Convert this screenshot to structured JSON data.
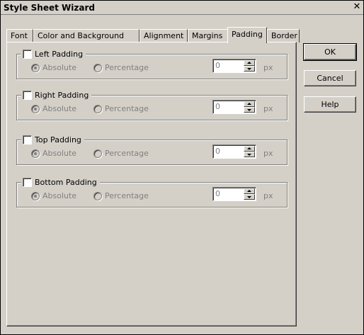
{
  "window": {
    "title": "Style Sheet Wizard",
    "close_glyph": "✕"
  },
  "tabs": [
    {
      "label": "Font",
      "active": false
    },
    {
      "label": "Color and Background",
      "active": false
    },
    {
      "label": "Alignment",
      "active": false
    },
    {
      "label": "Margins",
      "active": false
    },
    {
      "label": "Padding",
      "active": true
    },
    {
      "label": "Border",
      "active": false
    }
  ],
  "groups": [
    {
      "label": "Left Padding",
      "checked": false,
      "absolute_label": "Absolute",
      "percentage_label": "Percentage",
      "selected": "Absolute",
      "value": "0",
      "unit": "px"
    },
    {
      "label": "Right Padding",
      "checked": false,
      "absolute_label": "Absolute",
      "percentage_label": "Percentage",
      "selected": "Absolute",
      "value": "0",
      "unit": "px"
    },
    {
      "label": "Top Padding",
      "checked": false,
      "absolute_label": "Absolute",
      "percentage_label": "Percentage",
      "selected": "Absolute",
      "value": "0",
      "unit": "px"
    },
    {
      "label": "Bottom Padding",
      "checked": false,
      "absolute_label": "Absolute",
      "percentage_label": "Percentage",
      "selected": "Absolute",
      "value": "0",
      "unit": "px"
    }
  ],
  "buttons": {
    "ok": "OK",
    "cancel": "Cancel",
    "help": "Help"
  }
}
